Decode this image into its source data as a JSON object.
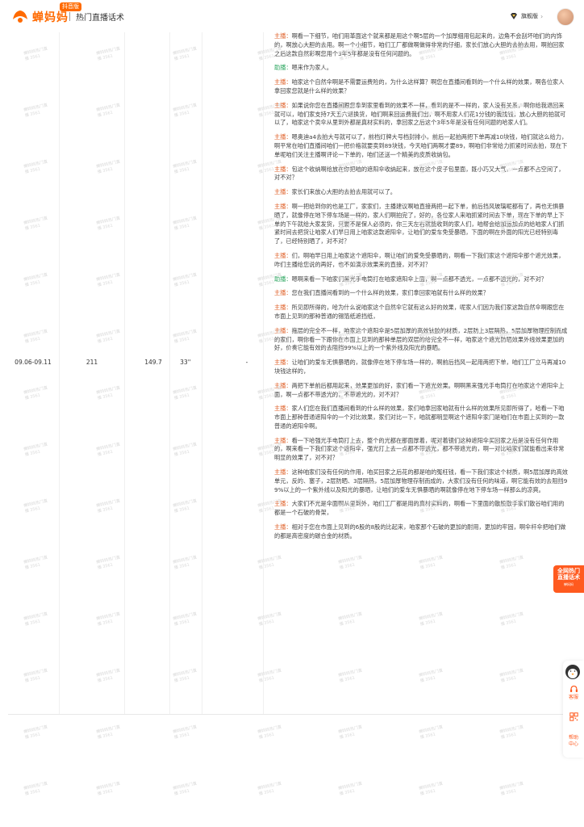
{
  "header": {
    "brand": "蝉妈妈",
    "brand_badge": "抖音版",
    "title": "热门直播话术",
    "user_label": "旗舰版"
  },
  "row": {
    "date_range": "09.06-09.11",
    "count": "211",
    "value": "149.7",
    "duration": "33''",
    "dash": "-"
  },
  "script": [
    {
      "speaker": "主播：",
      "role": "host",
      "text": "啊看一下细节，咱们用革面这个就来都是用这个啊5层的一个加厚细用包起来的，边角不会刮坏咱们的内饰的，啊放心大胆的去用。啊一个小细节，咱们工厂都做啊做得非常的仔细，家长们放心大胆的去拍去用，啊拍回家之后这款自然彩啊您用个3年5年都是没有任何问题的。"
    },
    {
      "speaker": "助播：",
      "role": "assist",
      "text": "嗯来作为家人。"
    },
    {
      "speaker": "主播：",
      "role": "host",
      "text": "咱家这个自然伞啊是不需要运费险的，为什么这样算？啊您在直播间看到的一个什么样的效果，啊各位家人拿回家您就是什么样的效果？"
    },
    {
      "speaker": "主播：",
      "role": "host",
      "text": "如果说你您在直播间跟您拿到家里看到的效果不一样，看到的是不一样的，家人没有关系，啊你给我退回来就可以，咱们家支持7天五六退换货，咱们啊来回运费我们出，啊不用家人们花1分钱的我找钱，放心大胆的拍就可以了，咱家这个卖伞从里到外都是真材实料的，拿回家之后这个3年5年是没有任何问题的哈家人们。"
    },
    {
      "speaker": "主播：",
      "role": "host",
      "text": "嗯奥迪a4去拍大号就可以了，前档灯牌大号档封排小，前后一起拍两把下单再减10块钱，咱们就这么给力，啊平常在咱们直播间咱们一把价格就要卖到89块钱，今天咱们两啊才要89，啊咱们非常给力抓紧时间去拍，现在下单呢咱们关注主播啊评论一下单的，咱们还送一个精美的皮质收纳包。"
    },
    {
      "speaker": "主播：",
      "role": "host",
      "text": "包这个收纳啊给放在你把咱的遮阳伞收纳起来，放在这个皮子包里面，既小巧又大气，一点都不占空间了，对不对？"
    },
    {
      "speaker": "主播：",
      "role": "host",
      "text": "家长们来放心大胆的去拍去用就可以了。"
    },
    {
      "speaker": "主播：",
      "role": "host",
      "text": "啊一把给到你的也是工厂，家家们，主播建议啊咱直接两把一起下单，前后挡风玻璃呢都有了，再也无惧暴晒了，就像停在地下停车场是一样的，家人们啊拍完了，好的，各位家人来咱抓紧时间去下单，现在下单的早上下单的下午就给大家发货，只要不是保人必须的，你三天左右就能收到的家人们，咱帮会给加运加点的给咱家人们抓紧时间去把货让咱家人们早日用上咱家这款遮阳伞，让咱们的爱车免受暴晒，下面的啊在外面的阳光已经特别毒了，已经特别晒了，对不对？"
    },
    {
      "speaker": "主播：",
      "role": "host",
      "text": "们，啊咱早日用上咱家这个遮阳伞，啊让咱们的爱免受暴晒的，啊看一下我们家这个遮阳伞那个遮光效果，咋们主播给您说的再好，也不如演示效果来的直接，对不对？"
    },
    {
      "speaker": "助播：",
      "role": "assist",
      "text": "嗯啊来看一下咱家们黑光手电筒打在咱家遮阳伞上面，啊一点都不透光，一点都不透光的，对不对？"
    },
    {
      "speaker": "主播：",
      "role": "host",
      "text": "您在我们直播间看到的一个什么样的效果，家们拿回家咱就有什么样的效果？"
    },
    {
      "speaker": "主播：",
      "role": "host",
      "text": "所见即所得的，哈为什么说咱家这个自然伞它就有这么好的效果，呢家人们因为我们家这款自然伞啊跟您在市面上见到的那种普通的锡箔纸遮挡纸，"
    },
    {
      "speaker": "主播：",
      "role": "host",
      "text": "拖层的完全不一样，咱家这个遮阳伞是5层加厚的高效钛胶的材质，2层防上3层隔热，5层加厚物理控制而成的家们，啊你看一下跟你在市面上见到的那种单层的双层的给完全不一样，咱家这个遮光防晒效果外线效果更加的好，价奏它能有效的去阻挡99%以上的一个紫外线及阳光的暴晒。"
    },
    {
      "speaker": "主播：",
      "role": "host",
      "text": "让咱们的爱车无惧暴晒的，就像停在地下停车场一样的，啊前后挡风一起用两把下单，咱们工厂立马再减10块钱这样的，"
    },
    {
      "speaker": "主播：",
      "role": "host",
      "text": "两把下单前后都用起来，效果更加的好，家们看一下遮光效果。啊啊黑来强光手电筒打在咱家这个遮阳伞上面，啊一点都不带透光的，不带遮光的，对不对？"
    },
    {
      "speaker": "主播：",
      "role": "host",
      "text": "家人们您在我们直播间看到的什么样的效果，家们咱拿回家咱就有什么样的效果所见即所得了，哈看一下咱市面上那种普通遮阳伞的一个对比效果，家们对比一下，咱就都明显啊这个遮阳伞家门是咱们在市面上买到的一款普通的遮阳伞啊。"
    },
    {
      "speaker": "主播：",
      "role": "host",
      "text": "看一下哈强光手电筒打上去，整个的光都在那面厚着，呢对着镜们这种遮阳伞买回家之后是没有任何作用的，啊来看一下我们家这个遮阳伞，强光打上去一点都不带透光，都不带遮光的，啊一对比咱家们就能看出来非常明显的效果了，对不对？"
    },
    {
      "speaker": "主播：",
      "role": "host",
      "text": "这种咱家们没有任何的作用，咱买回家之后花的都是咱的冤枉钱，看一下我们家这个材质，啊5层加厚的高效单元，反的、塞子，2层防晒、3层隔热，5层加厚物理存制而成的，大家们没有任何的味道，啊它能有效的去阻挡99%以上的一个紫外线以及阳光的暴晒，让咱们的爱车无惧暴晒的啊就像停在地下停车场一样那么的凉爽。"
    },
    {
      "speaker": "主播：",
      "role": "host",
      "text": "大家们不光是伞面啊从里到外，咱们工厂都是用的真材实料的，啊看一下里面的散股散手家们散谷咱们用的都是一个石破的骨架，"
    },
    {
      "speaker": "主播：",
      "role": "host",
      "text": "相对于您在市面上见到的6股的8股的比起来，咱家那个石破的更加的耐用，更加的牢固，啊伞杆伞把咱们做的都是高密度的碳合金的材质。"
    }
  ],
  "sidebar": {
    "promo_title": "全网热门直播话术",
    "promo_sub": "蝉妈妈",
    "service_label": "客服",
    "help_label": "帮助中心"
  },
  "watermark_text": "蝉妈妈热门直播 3561",
  "colors": {
    "brand": "#ff6a00",
    "host_speaker": "#e0622a",
    "assist_speaker": "#2aa55e",
    "promo_bg": "#ff5a1f"
  }
}
